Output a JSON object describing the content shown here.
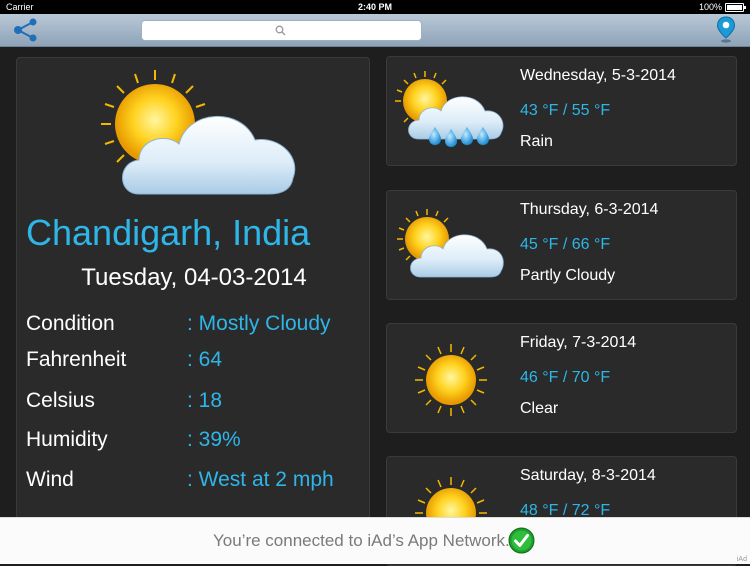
{
  "status_bar": {
    "carrier": "Carrier",
    "time": "2:40 PM",
    "battery": "100%"
  },
  "nav": {
    "search_placeholder": "",
    "share_icon": "share-icon",
    "pin_icon": "location-pin-icon",
    "accent_color": "#2eb6e8"
  },
  "current": {
    "city": "Chandigarh, India",
    "date": "Tuesday, 04-03-2014",
    "icon": "partly-cloudy-icon",
    "details": [
      {
        "label": "Condition",
        "value": ": Mostly Cloudy"
      },
      {
        "label": "Fahrenheit",
        "value": ": 64"
      },
      {
        "label": "Celsius",
        "value": ": 18"
      },
      {
        "label": "Humidity",
        "value": ": 39%"
      },
      {
        "label": "Wind",
        "value": ": West at 2 mph"
      }
    ]
  },
  "forecast": [
    {
      "day": "Wednesday, 5-3-2014",
      "temps": "43 °F / 55 °F",
      "condition": "Rain",
      "icon": "rain-icon"
    },
    {
      "day": "Thursday, 6-3-2014",
      "temps": "45 °F / 66 °F",
      "condition": "Partly Cloudy",
      "icon": "partly-cloudy-icon"
    },
    {
      "day": "Friday, 7-3-2014",
      "temps": "46 °F / 70 °F",
      "condition": "Clear",
      "icon": "sun-icon"
    },
    {
      "day": "Saturday, 8-3-2014",
      "temps": "48 °F / 72 °F",
      "condition": "",
      "icon": "sun-icon"
    }
  ],
  "ad": {
    "text": "You’re connected to iAd’s App Network.",
    "tag": "iAd",
    "check_icon": "checkmark-icon"
  }
}
